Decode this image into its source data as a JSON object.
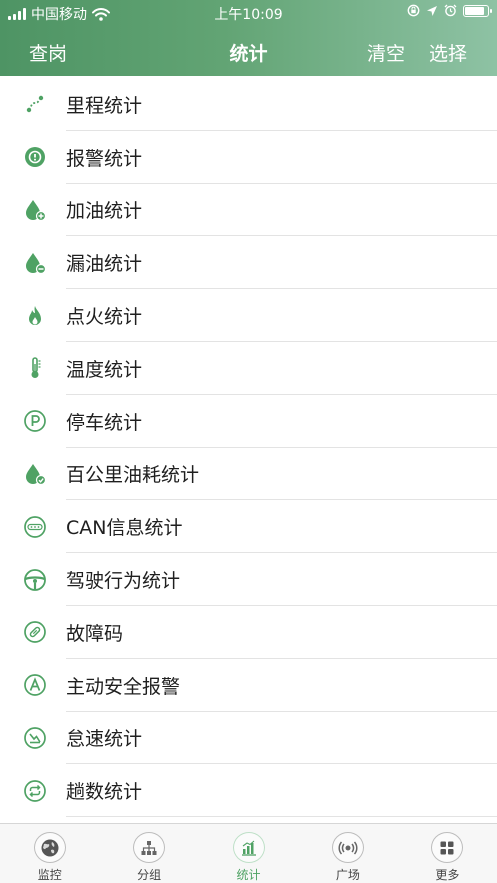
{
  "status_bar": {
    "carrier": "中国移动",
    "time": "上午10:09"
  },
  "nav": {
    "left_label": "查岗",
    "title": "统计",
    "clear_label": "清空",
    "select_label": "选择"
  },
  "items": [
    {
      "label": "里程统计",
      "icon": "route-icon"
    },
    {
      "label": "报警统计",
      "icon": "alarm-icon"
    },
    {
      "label": "加油统计",
      "icon": "fuel-add-icon"
    },
    {
      "label": "漏油统计",
      "icon": "fuel-leak-icon"
    },
    {
      "label": "点火统计",
      "icon": "flame-icon"
    },
    {
      "label": "温度统计",
      "icon": "thermometer-icon"
    },
    {
      "label": "停车统计",
      "icon": "parking-icon"
    },
    {
      "label": "百公里油耗统计",
      "icon": "fuel-consumption-icon"
    },
    {
      "label": "CAN信息统计",
      "icon": "obd-icon"
    },
    {
      "label": "驾驶行为统计",
      "icon": "steering-wheel-icon"
    },
    {
      "label": "故障码",
      "icon": "fault-code-icon"
    },
    {
      "label": "主动安全报警",
      "icon": "active-safety-icon"
    },
    {
      "label": "怠速统计",
      "icon": "idle-speed-icon"
    },
    {
      "label": "趟数统计",
      "icon": "trips-icon"
    }
  ],
  "tabs": [
    {
      "label": "监控",
      "icon": "globe-icon",
      "active": false
    },
    {
      "label": "分组",
      "icon": "group-icon",
      "active": false
    },
    {
      "label": "统计",
      "icon": "statistics-icon",
      "active": true
    },
    {
      "label": "广场",
      "icon": "broadcast-icon",
      "active": false
    },
    {
      "label": "更多",
      "icon": "more-grid-icon",
      "active": false
    }
  ],
  "colors": {
    "accent": "#4fa264",
    "header_start": "#4e9464",
    "header_end": "#8ec2a4"
  }
}
